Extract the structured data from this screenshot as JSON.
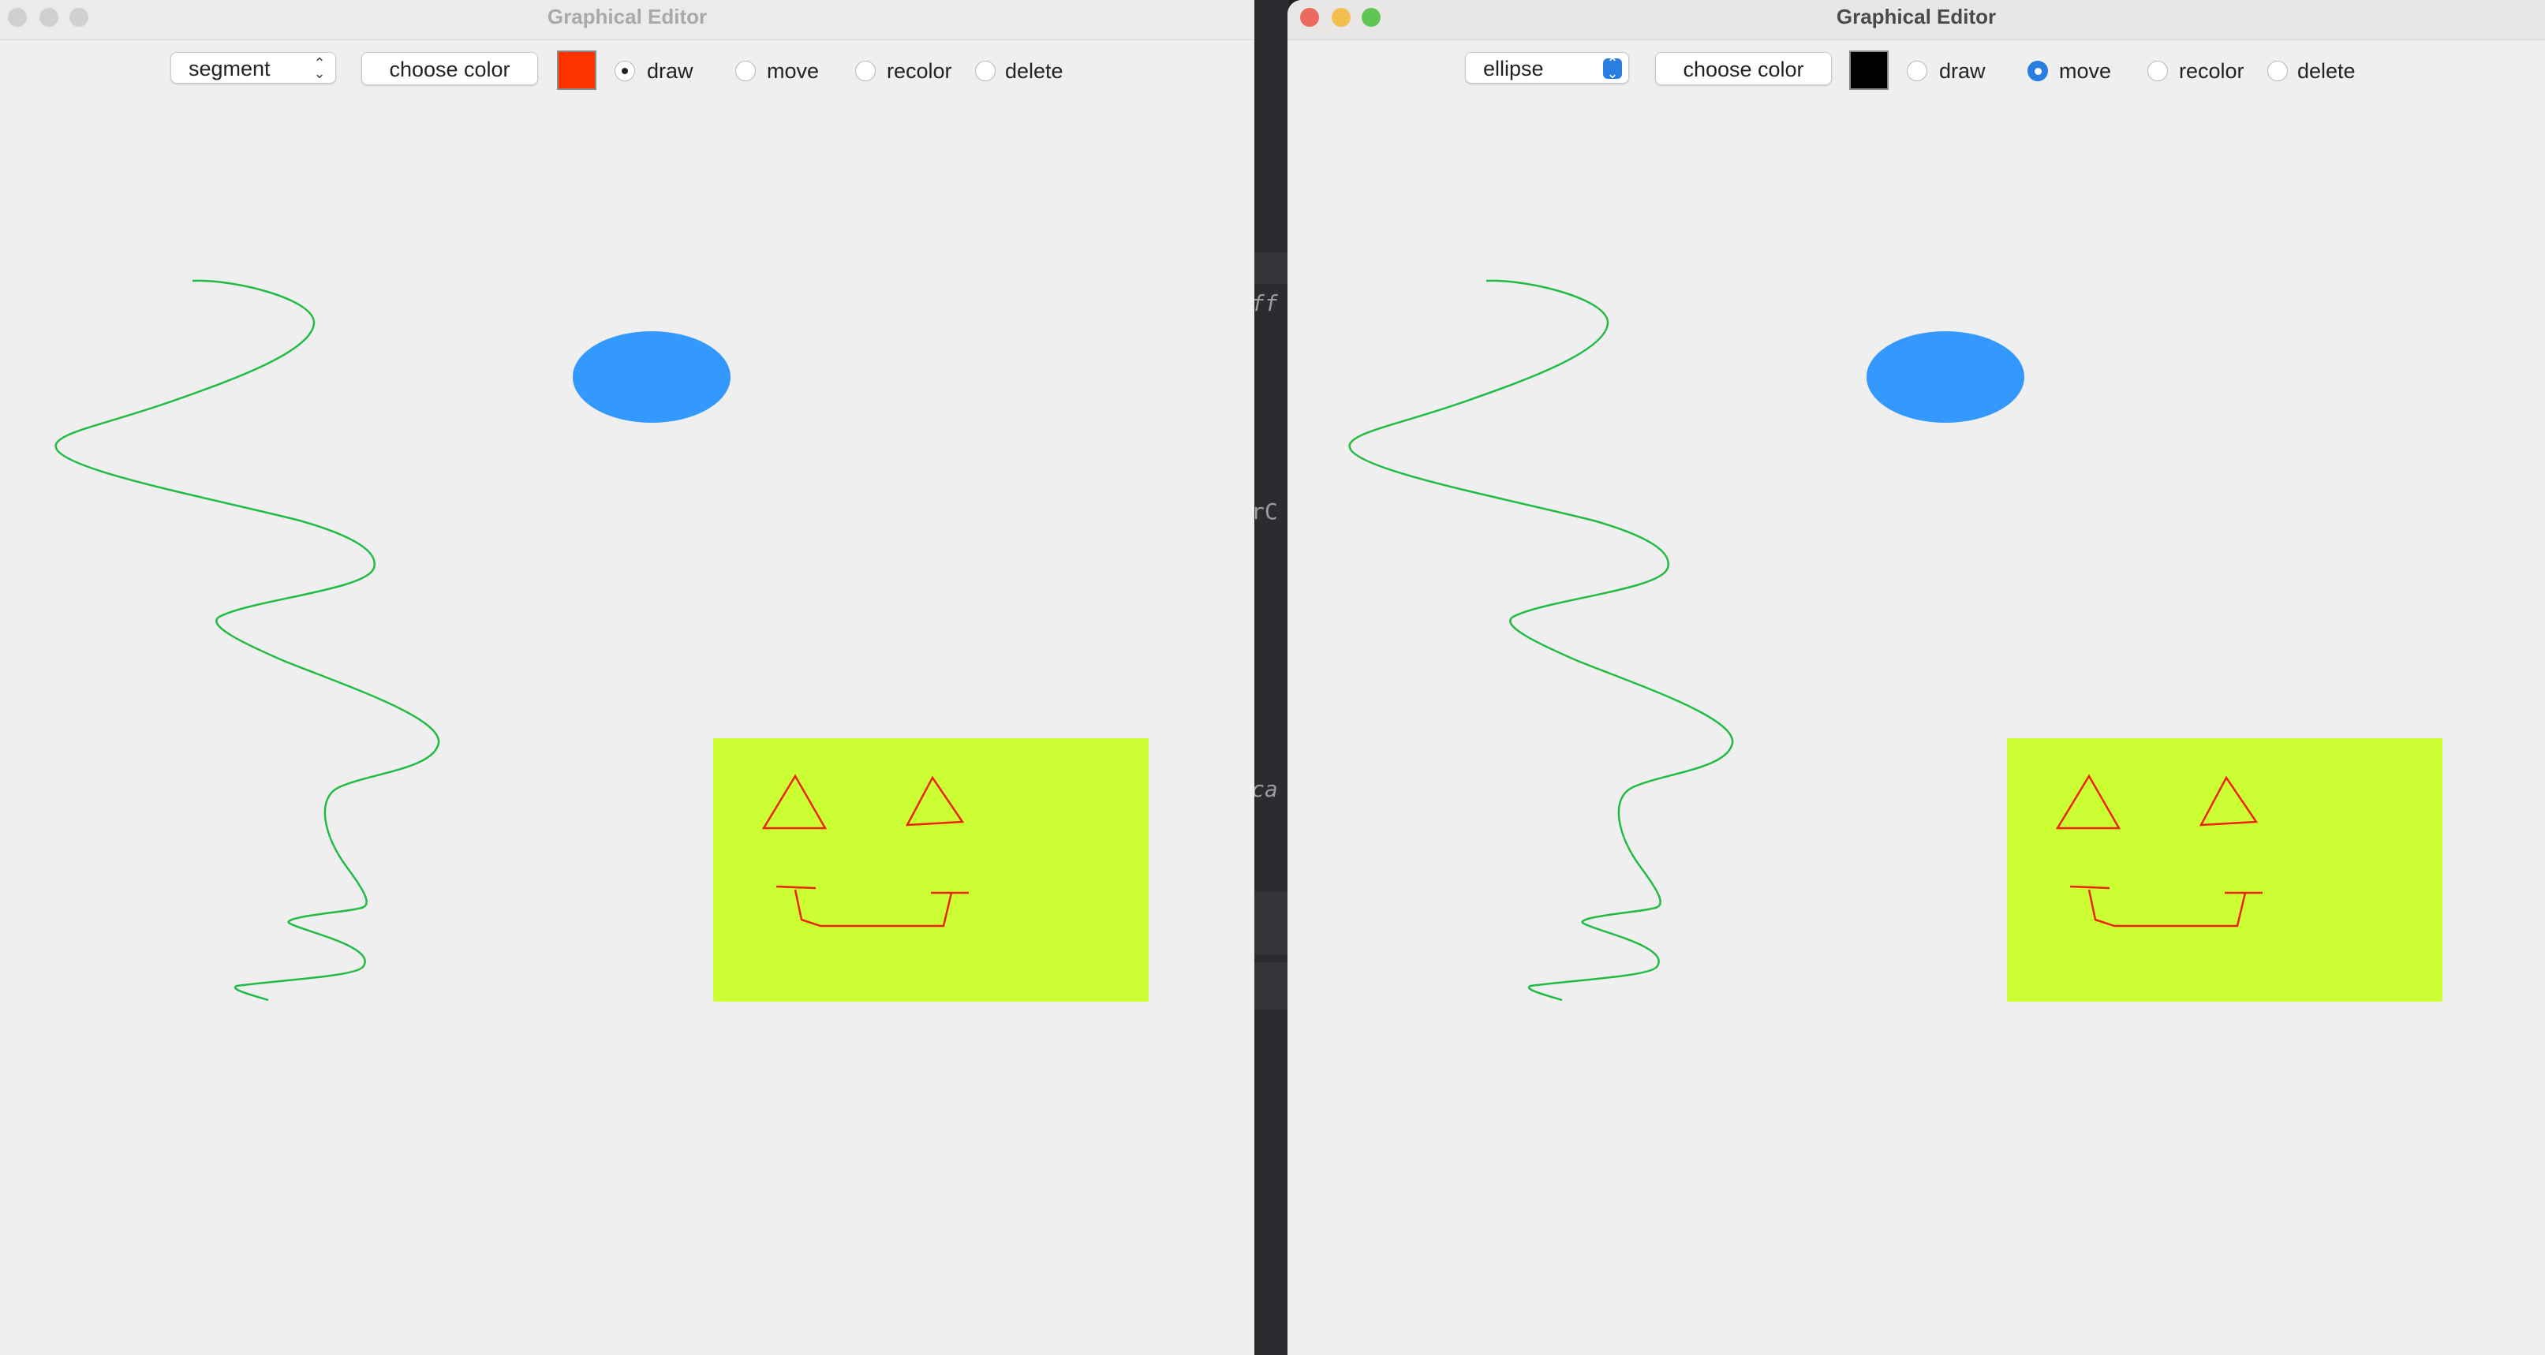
{
  "windows": [
    {
      "title": "Graphical Editor",
      "active": false,
      "shape_select": "segment",
      "choose_color_label": "choose color",
      "current_color": "#ff3300",
      "modes": [
        "draw",
        "move",
        "recolor",
        "delete"
      ],
      "selected_mode": "draw"
    },
    {
      "title": "Graphical Editor",
      "active": true,
      "shape_select": "ellipse",
      "choose_color_label": "choose color",
      "current_color": "#000000",
      "modes": [
        "draw",
        "move",
        "recolor",
        "delete"
      ],
      "selected_mode": "move"
    }
  ],
  "background_snippets": [
    "ff",
    "rC",
    "ca"
  ],
  "colors": {
    "squiggle": "#22bb44",
    "ellipse": "#3399ff",
    "rectangle": "#ccff33",
    "face": "#ee2200",
    "traffic_close": "#ed6a5e",
    "traffic_min": "#f5bf4f",
    "traffic_max": "#61c554",
    "traffic_inactive": "#d0d0d0"
  }
}
